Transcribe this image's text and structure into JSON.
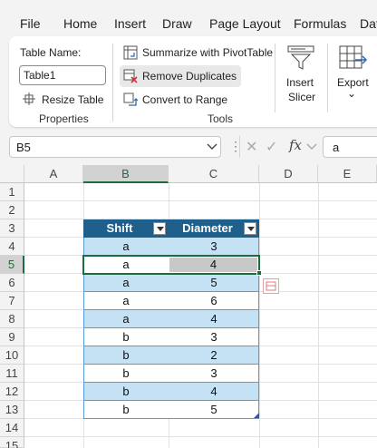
{
  "menu": {
    "items": [
      "File",
      "Home",
      "Insert",
      "Draw",
      "Page Layout",
      "Formulas",
      "Dat"
    ]
  },
  "ribbon": {
    "properties": {
      "table_name_label": "Table Name:",
      "table_name_value": "Table1",
      "resize_table": "Resize Table",
      "group_label": "Properties"
    },
    "tools": {
      "summarize_pivot": "Summarize with PivotTable",
      "remove_duplicates": "Remove Duplicates",
      "convert_to_range": "Convert to Range",
      "group_label": "Tools"
    },
    "insert_slicer": {
      "line1": "Insert",
      "line2": "Slicer"
    },
    "export": {
      "label": "Export",
      "chevron": "⌄"
    }
  },
  "formula_bar": {
    "name_box": "B5",
    "cancel_glyph": "✕",
    "enter_glyph": "✓",
    "fx_glyph": "fx",
    "value": "a"
  },
  "grid": {
    "columns": [
      "A",
      "B",
      "C",
      "D",
      "E"
    ],
    "rows": [
      "1",
      "2",
      "3",
      "4",
      "5",
      "6",
      "7",
      "8",
      "9",
      "10",
      "11",
      "12",
      "13",
      "14",
      "15"
    ],
    "selected_cell": "B5"
  },
  "table": {
    "headers": [
      "Shift",
      "Diameter"
    ],
    "rows": [
      [
        "a",
        "3"
      ],
      [
        "a",
        "4"
      ],
      [
        "a",
        "5"
      ],
      [
        "a",
        "6"
      ],
      [
        "a",
        "4"
      ],
      [
        "b",
        "3"
      ],
      [
        "b",
        "2"
      ],
      [
        "b",
        "3"
      ],
      [
        "b",
        "4"
      ],
      [
        "b",
        "5"
      ]
    ]
  },
  "colors": {
    "header_fill": "#1f5f8b",
    "band_fill": "#c5e2f5",
    "selection_green": "#1e6b3d",
    "table_border": "#5b9bd5"
  }
}
